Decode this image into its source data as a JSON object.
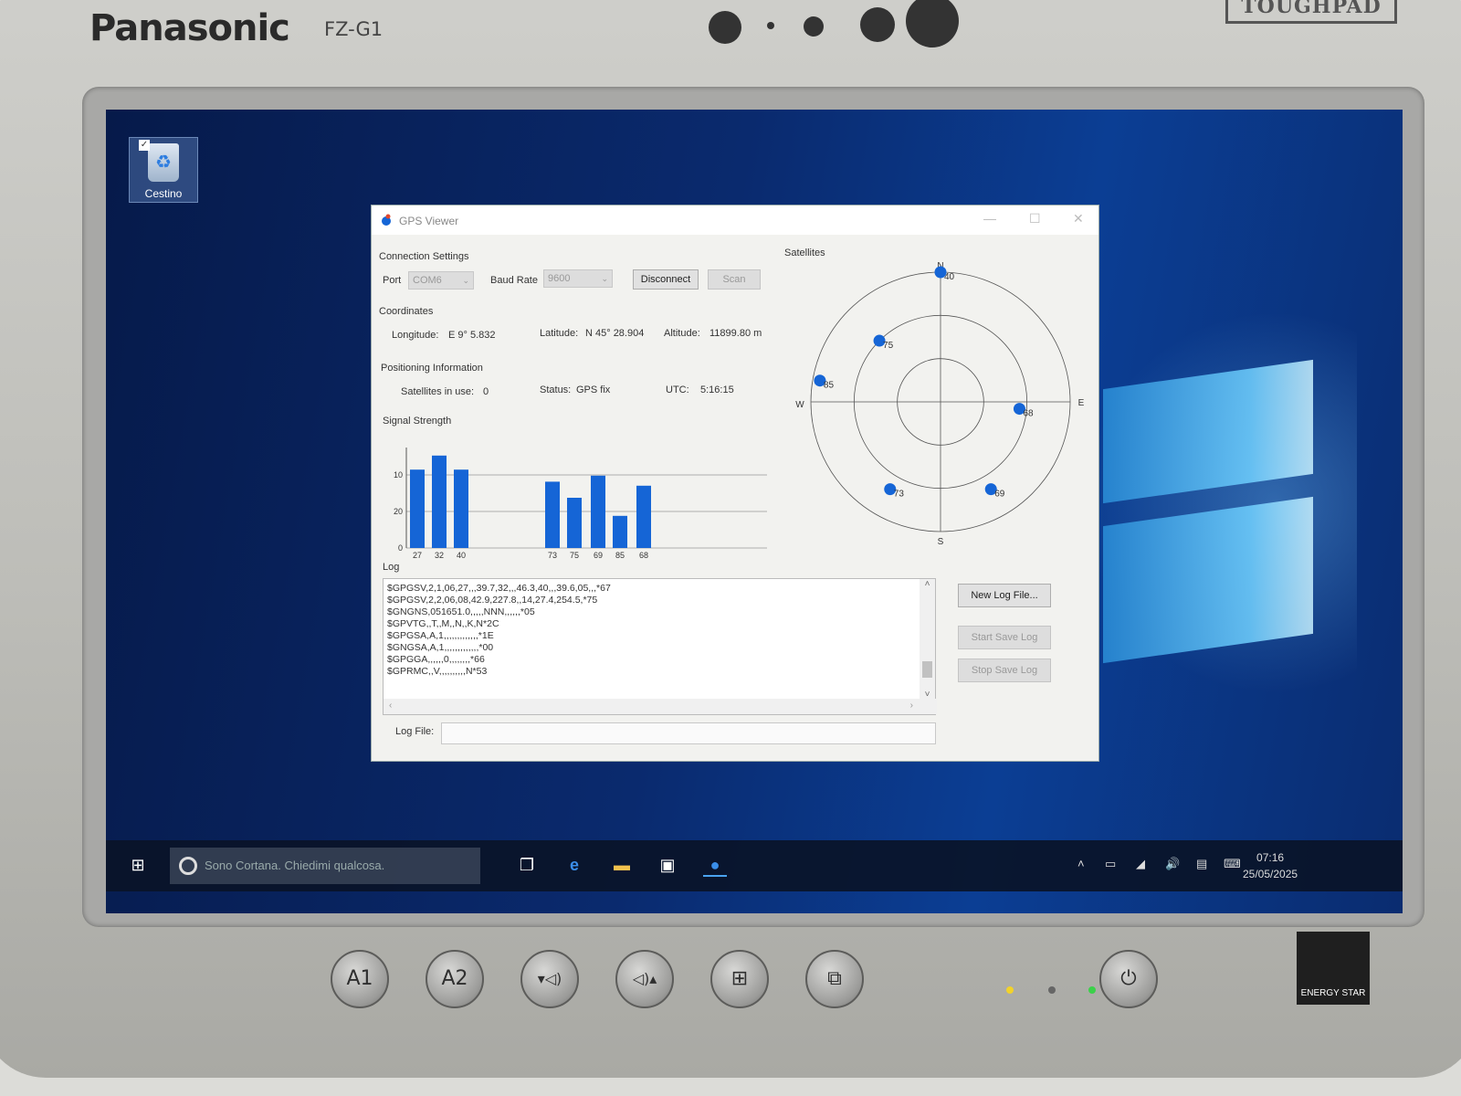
{
  "device": {
    "brand": "Panasonic",
    "model": "FZ-G1",
    "badge": "TOUGHPAD",
    "buttons": [
      "A1",
      "A2"
    ],
    "energy_label": "ENERGY STAR"
  },
  "desktop": {
    "icon_label": "Cestino"
  },
  "window": {
    "title": "GPS Viewer",
    "connection": {
      "section": "Connection Settings",
      "port_label": "Port",
      "port_value": "COM6",
      "baud_label": "Baud Rate",
      "baud_value": "9600",
      "disconnect_label": "Disconnect",
      "scan_label": "Scan"
    },
    "coordinates": {
      "section": "Coordinates",
      "longitude_label": "Longitude:",
      "longitude_value": "E 9° 5.832",
      "latitude_label": "Latitude:",
      "latitude_value": "N 45° 28.904",
      "altitude_label": "Altitude:",
      "altitude_value": "11899.80 m"
    },
    "positioning": {
      "section": "Positioning Information",
      "sats_label": "Satellites in use:",
      "sats_value": "0",
      "status_label": "Status:",
      "status_value": "GPS fix",
      "utc_label": "UTC:",
      "utc_value": "5:16:15"
    },
    "signal_section": "Signal Strength",
    "satellites_section": "Satellites",
    "log": {
      "section": "Log",
      "lines": [
        "$GPGSV,2,1,06,27,,,39.7,32,,,46.3,40,,,39.6,05,,,*67",
        "$GPGSV,2,2,06,08,42.9,227.8,,14,27.4,254.5,*75",
        "$GNGNS,051651.0,,,,,NNN,,,,,,*05",
        "$GPVTG,,T,,M,,N,,K,N*2C",
        "$GPGSA,A,1,,,,,,,,,,,,,*1E",
        "$GNGSA,A,1,,,,,,,,,,,,,*00",
        "$GPGGA,,,,,,0,,,,,,,,*66",
        "$GPRMC,,V,,,,,,,,,,N*53"
      ],
      "new_log_label": "New Log File...",
      "start_label": "Start Save Log",
      "stop_label": "Stop Save Log",
      "file_label": "Log File:",
      "file_value": ""
    }
  },
  "chart_data": {
    "type": "bar",
    "title": "Signal Strength",
    "yticks": [
      "10",
      "20",
      "0"
    ],
    "categories": [
      "27",
      "32",
      "40",
      "73",
      "75",
      "69",
      "85",
      "68"
    ],
    "values": [
      39,
      46,
      39,
      33,
      25,
      36,
      16,
      31
    ]
  },
  "sky_plot": {
    "compass": [
      "N",
      "E",
      "S",
      "W"
    ],
    "satellites": [
      {
        "id": "40",
        "az": 0,
        "el": 0
      },
      {
        "id": "75",
        "az": 315,
        "el": 30
      },
      {
        "id": "85",
        "az": 280,
        "el": 5
      },
      {
        "id": "68",
        "az": 95,
        "el": 35
      },
      {
        "id": "73",
        "az": 210,
        "el": 20
      },
      {
        "id": "69",
        "az": 150,
        "el": 20
      }
    ]
  },
  "taskbar": {
    "search_placeholder": "Sono Cortana. Chiedimi qualcosa.",
    "time": "07:16",
    "date": "25/05/2025"
  },
  "colors": {
    "bar": "#1565d6",
    "satellite": "#1565d6"
  }
}
